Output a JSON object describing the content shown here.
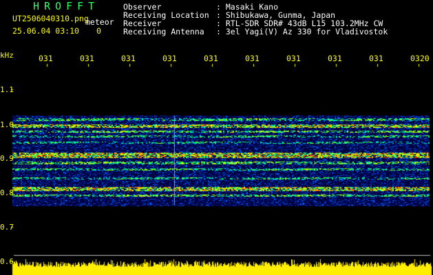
{
  "app": {
    "name": "HROFFT"
  },
  "file": {
    "name": "UT2506040310.png",
    "tag": "meteor"
  },
  "timestamp": {
    "datetime": "25.06.04 03:10",
    "count": "0"
  },
  "info": {
    "rows": [
      {
        "label": "Observer",
        "value": ": Masaki Kano"
      },
      {
        "label": "Receiving Location",
        "value": ": Shibukawa, Gunma, Japan"
      },
      {
        "label": "Receiver",
        "value": ": RTL-SDR SDR# 43dB L15 103.2MHz CW"
      },
      {
        "label": "Receiving Antenna",
        "value": ": 3el Yagi(V) Az 330 for Vladivostok"
      }
    ]
  },
  "axis": {
    "unit": "kHz",
    "time_ticks": [
      "031",
      "031",
      "031",
      "031",
      "031",
      "031",
      "031",
      "031",
      "031",
      "0320"
    ],
    "freq_ticks": [
      "1.1",
      "1.0",
      "0.9",
      "0.8",
      "0.7",
      "0.6"
    ]
  },
  "colors": {
    "background": "#000000",
    "label_white": "#ffffff",
    "label_yellow": "#ffff00",
    "title_green": "#33ff66",
    "noise_floor": "#ffee00"
  }
}
